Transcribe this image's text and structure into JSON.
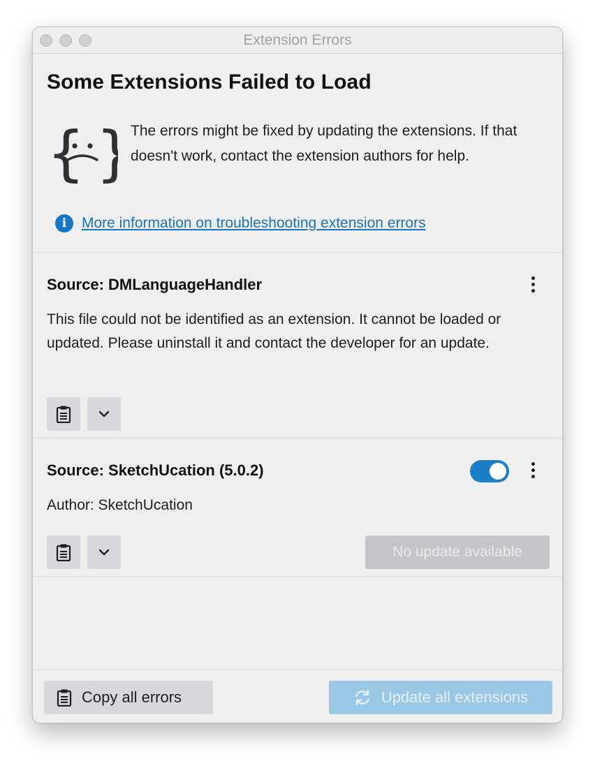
{
  "window": {
    "title": "Extension Errors"
  },
  "header": {
    "heading": "Some Extensions Failed to Load",
    "intro": "The errors might be fixed by updating the extensions. If that doesn't work, contact the extension authors for help.",
    "face_icon": "sad-braces-icon",
    "face_text_left": "{",
    "face_text_right": "}"
  },
  "info": {
    "icon": "info-icon",
    "icon_glyph": "i",
    "link": "More information on troubleshooting extension errors"
  },
  "extensions": [
    {
      "source": "Source: DMLanguageHandler",
      "description": "This file could not be identified as an extension. It cannot be loaded or updated. Please uninstall it and contact the developer for an update."
    },
    {
      "source": "Source: SketchUcation (5.0.2)",
      "description": "Author: SketchUcation",
      "enabled": true,
      "update_label": "No update available"
    }
  ],
  "footer": {
    "copy_label": "Copy all errors",
    "update_label": "Update all extensions"
  },
  "colors": {
    "accent": "#1a7fc6",
    "link": "#1a73b8",
    "button_gray": "#d6d8de",
    "update_disabled": "#9ac7e3"
  }
}
